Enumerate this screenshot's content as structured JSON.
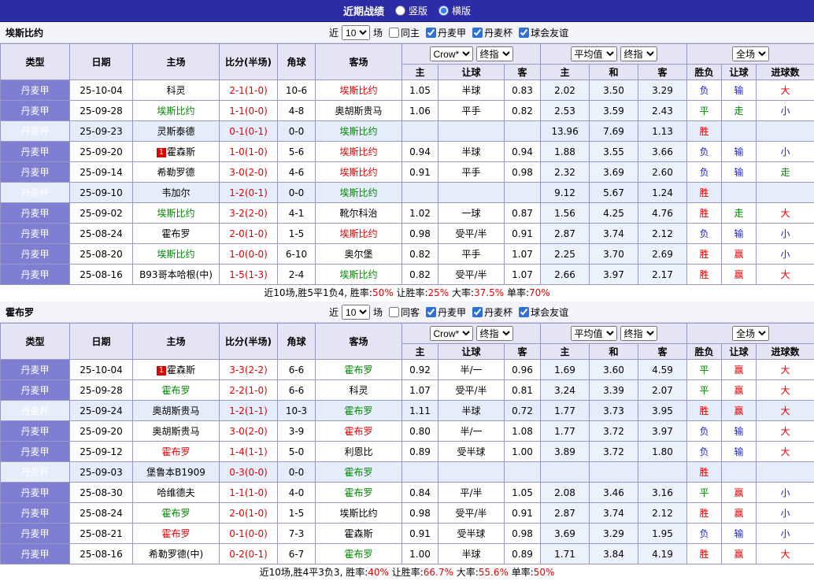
{
  "topbar": {
    "title": "近期战绩",
    "layout_options": [
      {
        "label": "竖版",
        "selected": false
      },
      {
        "label": "横版",
        "selected": true
      }
    ]
  },
  "table_header": {
    "cols": [
      "类型",
      "日期",
      "主场",
      "比分(半场)",
      "角球",
      "客场"
    ],
    "sub_asia": [
      "主",
      "让球",
      "客"
    ],
    "sub_euro": [
      "主",
      "和",
      "客"
    ],
    "sub_result": [
      "胜负",
      "让球",
      "进球数"
    ],
    "selects": {
      "asia_company": "Crow*",
      "asia_time": "终指",
      "euro_company": "平均值",
      "euro_time": "终指",
      "scope": "全场"
    }
  },
  "result_color_map": {
    "胜": "red",
    "赢": "red",
    "大": "red",
    "平": "green",
    "走": "green",
    "负": "blue",
    "输": "blue",
    "小": "blue"
  },
  "sections": [
    {
      "team": "埃斯比约",
      "filter": {
        "near_label": "近",
        "count": "10",
        "unit": "场",
        "checkboxes": [
          {
            "label": "同主",
            "checked": false
          },
          {
            "label": "丹麦甲",
            "checked": true
          },
          {
            "label": "丹麦杯",
            "checked": true
          },
          {
            "label": "球会友谊",
            "checked": true
          }
        ]
      },
      "rows": [
        {
          "league": "丹麦甲",
          "cup": false,
          "date": "25-10-04",
          "home": "科灵",
          "home_color": "k",
          "score": "2-1(1-0)",
          "corner": "10-6",
          "away": "埃斯比约",
          "away_color": "r",
          "asia": [
            "1.05",
            "半球",
            "0.83"
          ],
          "euro": [
            "2.02",
            "3.50",
            "3.29"
          ],
          "res": [
            "负",
            "输",
            "大"
          ]
        },
        {
          "league": "丹麦甲",
          "cup": false,
          "date": "25-09-28",
          "home": "埃斯比约",
          "home_color": "g",
          "score": "1-1(0-0)",
          "corner": "4-8",
          "away": "奥胡斯贵马",
          "away_color": "k",
          "asia": [
            "1.06",
            "平手",
            "0.82"
          ],
          "euro": [
            "2.53",
            "3.59",
            "2.43"
          ],
          "res": [
            "平",
            "走",
            "小"
          ]
        },
        {
          "league": "丹麦杯",
          "cup": true,
          "date": "25-09-23",
          "home": "灵斯泰德",
          "home_color": "k",
          "score": "0-1(0-1)",
          "corner": "0-0",
          "away": "埃斯比约",
          "away_color": "g",
          "asia": [
            "",
            "",
            ""
          ],
          "euro": [
            "13.96",
            "7.69",
            "1.13"
          ],
          "res": [
            "胜",
            "",
            ""
          ]
        },
        {
          "league": "丹麦甲",
          "cup": false,
          "date": "25-09-20",
          "home": "霍森斯",
          "home_badge": "1",
          "home_color": "k",
          "score": "1-0(1-0)",
          "corner": "5-6",
          "away": "埃斯比约",
          "away_color": "r",
          "asia": [
            "0.94",
            "半球",
            "0.94"
          ],
          "euro": [
            "1.88",
            "3.55",
            "3.66"
          ],
          "res": [
            "负",
            "输",
            "小"
          ]
        },
        {
          "league": "丹麦甲",
          "cup": false,
          "date": "25-09-14",
          "home": "希勒罗德",
          "home_color": "k",
          "score": "3-0(2-0)",
          "corner": "4-6",
          "away": "埃斯比约",
          "away_color": "r",
          "asia": [
            "0.91",
            "平手",
            "0.98"
          ],
          "euro": [
            "2.32",
            "3.69",
            "2.60"
          ],
          "res": [
            "负",
            "输",
            "走"
          ]
        },
        {
          "league": "丹麦杯",
          "cup": true,
          "date": "25-09-10",
          "home": "韦加尔",
          "home_color": "k",
          "score": "1-2(0-1)",
          "corner": "0-0",
          "away": "埃斯比约",
          "away_color": "g",
          "asia": [
            "",
            "",
            ""
          ],
          "euro": [
            "9.12",
            "5.67",
            "1.24"
          ],
          "res": [
            "胜",
            "",
            ""
          ]
        },
        {
          "league": "丹麦甲",
          "cup": false,
          "date": "25-09-02",
          "home": "埃斯比约",
          "home_color": "g",
          "score": "3-2(2-0)",
          "corner": "4-1",
          "away": "靴尔科治",
          "away_color": "k",
          "asia": [
            "1.02",
            "一球",
            "0.87"
          ],
          "euro": [
            "1.56",
            "4.25",
            "4.76"
          ],
          "res": [
            "胜",
            "走",
            "大"
          ]
        },
        {
          "league": "丹麦甲",
          "cup": false,
          "date": "25-08-24",
          "home": "霍布罗",
          "home_color": "k",
          "score": "2-0(1-0)",
          "corner": "1-5",
          "away": "埃斯比约",
          "away_color": "r",
          "asia": [
            "0.98",
            "受平/半",
            "0.91"
          ],
          "euro": [
            "2.87",
            "3.74",
            "2.12"
          ],
          "res": [
            "负",
            "输",
            "小"
          ]
        },
        {
          "league": "丹麦甲",
          "cup": false,
          "date": "25-08-20",
          "home": "埃斯比约",
          "home_color": "g",
          "score": "1-0(0-0)",
          "corner": "6-10",
          "away": "奥尔堡",
          "away_color": "k",
          "asia": [
            "0.82",
            "平手",
            "1.07"
          ],
          "euro": [
            "2.25",
            "3.70",
            "2.69"
          ],
          "res": [
            "胜",
            "赢",
            "小"
          ]
        },
        {
          "league": "丹麦甲",
          "cup": false,
          "date": "25-08-16",
          "home": "B93哥本哈根(中)",
          "home_color": "k",
          "score": "1-5(1-3)",
          "corner": "2-4",
          "away": "埃斯比约",
          "away_color": "g",
          "asia": [
            "0.82",
            "受平/半",
            "1.07"
          ],
          "euro": [
            "2.66",
            "3.97",
            "2.17"
          ],
          "res": [
            "胜",
            "赢",
            "大"
          ]
        }
      ],
      "summary": [
        {
          "text": "近10场,胜5平1负4, 胜率:"
        },
        {
          "text": "50%",
          "red": true
        },
        {
          "text": " 让胜率:"
        },
        {
          "text": "25%",
          "red": true
        },
        {
          "text": " 大率:"
        },
        {
          "text": "37.5%",
          "red": true
        },
        {
          "text": " 单率:"
        },
        {
          "text": "70%",
          "red": true
        }
      ]
    },
    {
      "team": "霍布罗",
      "filter": {
        "near_label": "近",
        "count": "10",
        "unit": "场",
        "checkboxes": [
          {
            "label": "同客",
            "checked": false
          },
          {
            "label": "丹麦甲",
            "checked": true
          },
          {
            "label": "丹麦杯",
            "checked": true
          },
          {
            "label": "球会友谊",
            "checked": true
          }
        ]
      },
      "rows": [
        {
          "league": "丹麦甲",
          "cup": false,
          "date": "25-10-04",
          "home": "霍森斯",
          "home_badge": "1",
          "home_color": "k",
          "score": "3-3(2-2)",
          "corner": "6-6",
          "away": "霍布罗",
          "away_color": "g",
          "asia": [
            "0.92",
            "半/一",
            "0.96"
          ],
          "euro": [
            "1.69",
            "3.60",
            "4.59"
          ],
          "res": [
            "平",
            "赢",
            "大"
          ]
        },
        {
          "league": "丹麦甲",
          "cup": false,
          "date": "25-09-28",
          "home": "霍布罗",
          "home_color": "g",
          "score": "2-2(1-0)",
          "corner": "6-6",
          "away": "科灵",
          "away_color": "k",
          "asia": [
            "1.07",
            "受平/半",
            "0.81"
          ],
          "euro": [
            "3.24",
            "3.39",
            "2.07"
          ],
          "res": [
            "平",
            "赢",
            "大"
          ]
        },
        {
          "league": "丹麦杯",
          "cup": true,
          "date": "25-09-24",
          "home": "奥胡斯贵马",
          "home_color": "k",
          "score": "1-2(1-1)",
          "corner": "10-3",
          "away": "霍布罗",
          "away_color": "g",
          "asia": [
            "1.11",
            "半球",
            "0.72"
          ],
          "euro": [
            "1.77",
            "3.73",
            "3.95"
          ],
          "res": [
            "胜",
            "赢",
            "大"
          ]
        },
        {
          "league": "丹麦甲",
          "cup": false,
          "date": "25-09-20",
          "home": "奥胡斯贵马",
          "home_color": "k",
          "score": "3-0(2-0)",
          "corner": "3-9",
          "away": "霍布罗",
          "away_color": "r",
          "asia": [
            "0.80",
            "半/一",
            "1.08"
          ],
          "euro": [
            "1.77",
            "3.72",
            "3.97"
          ],
          "res": [
            "负",
            "输",
            "大"
          ]
        },
        {
          "league": "丹麦甲",
          "cup": false,
          "date": "25-09-12",
          "home": "霍布罗",
          "home_color": "r",
          "score": "1-4(1-1)",
          "corner": "5-0",
          "away": "利恩比",
          "away_color": "k",
          "asia": [
            "0.89",
            "受半球",
            "1.00"
          ],
          "euro": [
            "3.89",
            "3.72",
            "1.80"
          ],
          "res": [
            "负",
            "输",
            "大"
          ]
        },
        {
          "league": "丹麦杯",
          "cup": true,
          "date": "25-09-03",
          "home": "堡鲁本B1909",
          "home_color": "k",
          "score": "0-3(0-0)",
          "corner": "0-0",
          "away": "霍布罗",
          "away_color": "g",
          "asia": [
            "",
            "",
            ""
          ],
          "euro": [
            "",
            "",
            ""
          ],
          "res": [
            "胜",
            "",
            ""
          ]
        },
        {
          "league": "丹麦甲",
          "cup": false,
          "date": "25-08-30",
          "home": "哈维德夫",
          "home_color": "k",
          "score": "1-1(1-0)",
          "corner": "4-0",
          "away": "霍布罗",
          "away_color": "g",
          "asia": [
            "0.84",
            "平/半",
            "1.05"
          ],
          "euro": [
            "2.08",
            "3.46",
            "3.16"
          ],
          "res": [
            "平",
            "赢",
            "小"
          ]
        },
        {
          "league": "丹麦甲",
          "cup": false,
          "date": "25-08-24",
          "home": "霍布罗",
          "home_color": "g",
          "score": "2-0(1-0)",
          "corner": "1-5",
          "away": "埃斯比约",
          "away_color": "k",
          "asia": [
            "0.98",
            "受平/半",
            "0.91"
          ],
          "euro": [
            "2.87",
            "3.74",
            "2.12"
          ],
          "res": [
            "胜",
            "赢",
            "小"
          ]
        },
        {
          "league": "丹麦甲",
          "cup": false,
          "date": "25-08-21",
          "home": "霍布罗",
          "home_color": "r",
          "score": "0-1(0-0)",
          "corner": "7-3",
          "away": "霍森斯",
          "away_color": "k",
          "asia": [
            "0.91",
            "受半球",
            "0.98"
          ],
          "euro": [
            "3.69",
            "3.29",
            "1.95"
          ],
          "res": [
            "负",
            "输",
            "小"
          ]
        },
        {
          "league": "丹麦甲",
          "cup": false,
          "date": "25-08-16",
          "home": "希勒罗德(中)",
          "home_color": "k",
          "score": "0-2(0-1)",
          "corner": "6-7",
          "away": "霍布罗",
          "away_color": "g",
          "asia": [
            "1.00",
            "半球",
            "0.89"
          ],
          "euro": [
            "1.71",
            "3.84",
            "4.19"
          ],
          "res": [
            "胜",
            "赢",
            "大"
          ]
        }
      ],
      "summary": [
        {
          "text": "近10场,胜4平3负3, 胜率:"
        },
        {
          "text": "40%",
          "red": true
        },
        {
          "text": " 让胜率:"
        },
        {
          "text": "66.7%",
          "red": true
        },
        {
          "text": " 大率:"
        },
        {
          "text": "55.6%",
          "red": true
        },
        {
          "text": " 单率:"
        },
        {
          "text": "50%",
          "red": true
        }
      ]
    }
  ]
}
